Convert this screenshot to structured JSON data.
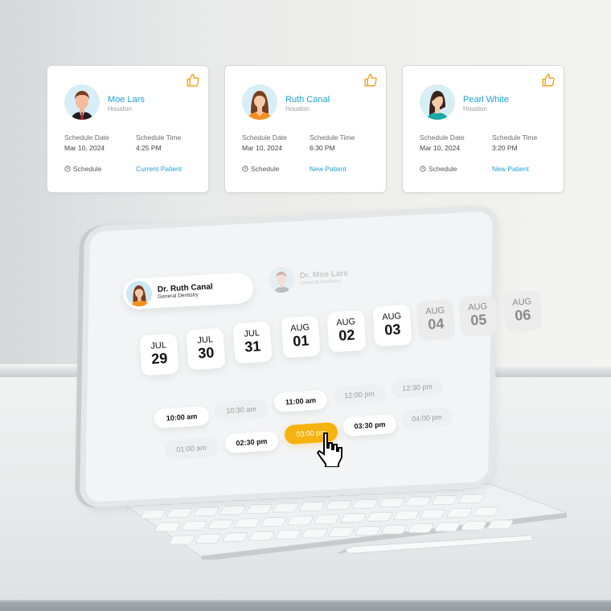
{
  "colors": {
    "accent_blue": "#1e9fd8",
    "accent_orange": "#f6b20e",
    "like_icon": "#f5a623"
  },
  "patient_cards": [
    {
      "name": "Moe Lars",
      "city": "Houston",
      "avatar": "male-avatar",
      "date_label": "Schedule Date",
      "date_value": "Mar 10, 2024",
      "time_label": "Schedule Time",
      "time_value": "4:25 PM",
      "schedule_label": "Schedule",
      "status": "Current Patient"
    },
    {
      "name": "Ruth Canal",
      "city": "Houston",
      "avatar": "female-avatar-orange",
      "date_label": "Schedule Date",
      "date_value": "Mar 10, 2024",
      "time_label": "Schedule Time",
      "time_value": "6:30 PM",
      "schedule_label": "Schedule",
      "status": "New Patient"
    },
    {
      "name": "Pearl White",
      "city": "Houston",
      "avatar": "female-avatar-teal",
      "date_label": "Schedule Date",
      "date_value": "Mar 10, 2024",
      "time_label": "Schedule Time",
      "time_value": "3:20 PM",
      "schedule_label": "Schedule",
      "status": "New Patient"
    }
  ],
  "tablet": {
    "doctors": [
      {
        "name": "Dr. Ruth Canal",
        "specialty": "General Dentistry",
        "active": true
      },
      {
        "name": "Dr. Moe Lars",
        "specialty": "General Dentistry",
        "active": false
      }
    ],
    "dates": [
      {
        "month": "JUL",
        "day": "29",
        "available": true
      },
      {
        "month": "JUL",
        "day": "30",
        "available": true
      },
      {
        "month": "JUL",
        "day": "31",
        "available": true
      },
      {
        "month": "AUG",
        "day": "01",
        "available": true
      },
      {
        "month": "AUG",
        "day": "02",
        "available": true
      },
      {
        "month": "AUG",
        "day": "03",
        "available": true
      },
      {
        "month": "AUG",
        "day": "04",
        "available": false
      },
      {
        "month": "AUG",
        "day": "05",
        "available": false
      },
      {
        "month": "AUG",
        "day": "06",
        "available": false
      }
    ],
    "time_slots": [
      {
        "label": "10:00 am",
        "state": "available"
      },
      {
        "label": "10:30 am",
        "state": "unavailable"
      },
      {
        "label": "11:00 am",
        "state": "available"
      },
      {
        "label": "12:00 pm",
        "state": "unavailable"
      },
      {
        "label": "12:30 pm",
        "state": "unavailable"
      },
      {
        "label": "01:00 am",
        "state": "unavailable"
      },
      {
        "label": "02:30 pm",
        "state": "available"
      },
      {
        "label": "03:00 pm",
        "state": "selected"
      },
      {
        "label": "03:30 pm",
        "state": "available"
      },
      {
        "label": "04:00 pm",
        "state": "unavailable"
      }
    ]
  }
}
